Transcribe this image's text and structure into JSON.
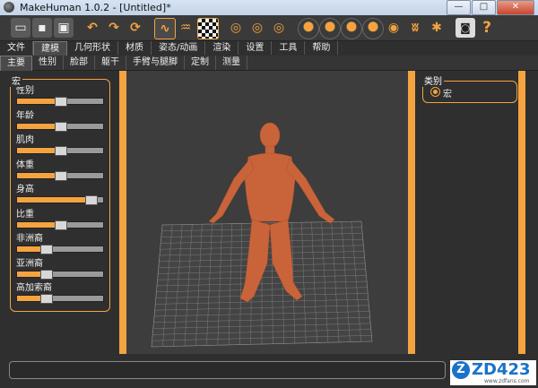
{
  "window": {
    "title": "MakeHuman 1.0.2 - [Untitled]*"
  },
  "window_buttons": {
    "minimize": "—",
    "maximize": "□",
    "close": "✕"
  },
  "toolbar": {
    "icons": [
      {
        "name": "new-file-icon",
        "glyph": "▭"
      },
      {
        "name": "save-icon",
        "glyph": "▪"
      },
      {
        "name": "export-icon",
        "glyph": "▣"
      },
      {
        "name": "undo-icon",
        "glyph": "↶"
      },
      {
        "name": "redo-icon",
        "glyph": "↷"
      },
      {
        "name": "reset-icon",
        "glyph": "⟳"
      },
      {
        "name": "wireframe-icon",
        "glyph": "∿"
      },
      {
        "name": "skeleton-icon",
        "glyph": "♒"
      },
      {
        "name": "checker-texture-icon",
        "glyph": ""
      },
      {
        "name": "front-view-icon",
        "glyph": "◎"
      },
      {
        "name": "back-view-icon",
        "glyph": "◎"
      },
      {
        "name": "left-view-icon",
        "glyph": "◎"
      },
      {
        "name": "right-view-icon",
        "glyph": "◎"
      },
      {
        "name": "top-view-icon",
        "glyph": "◎"
      },
      {
        "name": "bottom-view-icon",
        "glyph": "◎"
      },
      {
        "name": "reset-camera-icon",
        "glyph": "◎"
      },
      {
        "name": "smooth-icon",
        "glyph": "◉"
      },
      {
        "name": "hands-icon",
        "glyph": "ʬ"
      },
      {
        "name": "pose-icon",
        "glyph": "✱"
      },
      {
        "name": "screenshot-icon",
        "glyph": "◙"
      },
      {
        "name": "help-icon",
        "glyph": "?"
      }
    ]
  },
  "tabs": [
    "文件",
    "建模",
    "几何形状",
    "材质",
    "姿态/动画",
    "渲染",
    "设置",
    "工具",
    "帮助"
  ],
  "subtabs": [
    "主要",
    "性别",
    "脸部",
    "躯干",
    "手臂与腿脚",
    "定制",
    "测量"
  ],
  "left_panel": {
    "group_title": "宏",
    "sliders": [
      {
        "label": "性别",
        "value": 0.5
      },
      {
        "label": "年龄",
        "value": 0.5
      },
      {
        "label": "肌肉",
        "value": 0.5
      },
      {
        "label": "体重",
        "value": 0.5
      },
      {
        "label": "身高",
        "value": 0.85
      },
      {
        "label": "比重",
        "value": 0.5
      },
      {
        "label": "非洲裔",
        "value": 0.33
      },
      {
        "label": "亚洲裔",
        "value": 0.33
      },
      {
        "label": "高加索裔",
        "value": 0.33
      }
    ]
  },
  "right_panel": {
    "group_title": "类别",
    "options": [
      "宏"
    ]
  },
  "watermark": {
    "brand": "ZD423",
    "logo": "Z",
    "url": "www.zdfans.com"
  },
  "colors": {
    "accent": "#f4a340",
    "skin": "#c9643a",
    "panel": "#2f2f2f"
  }
}
